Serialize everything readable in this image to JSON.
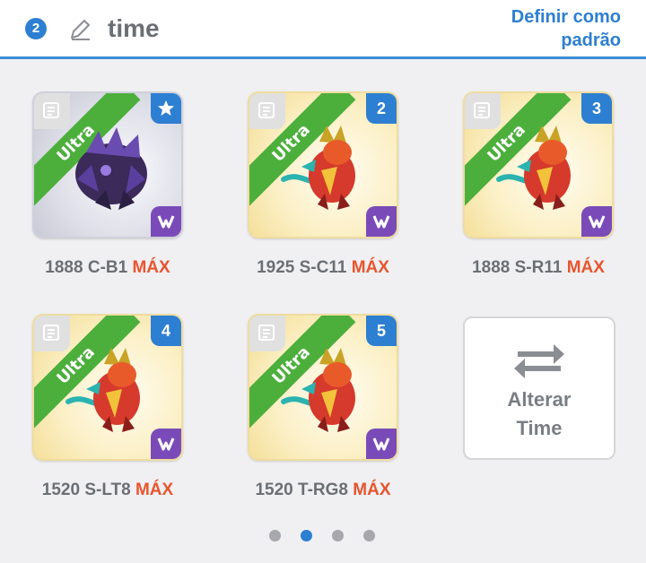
{
  "header": {
    "team_number": "2",
    "team_name": "time",
    "set_default_line1": "Definir como",
    "set_default_line2": "padrão"
  },
  "monsters": [
    {
      "rarity": "Ultra",
      "slot": "★",
      "leader": true,
      "name": "1888 C-B1",
      "max": "MÁX",
      "element": "dark",
      "bg": "gray"
    },
    {
      "rarity": "Ultra",
      "slot": "2",
      "leader": false,
      "name": "1925 S-C11",
      "max": "MÁX",
      "element": "dark",
      "bg": "gold"
    },
    {
      "rarity": "Ultra",
      "slot": "3",
      "leader": false,
      "name": "1888 S-R11",
      "max": "MÁX",
      "element": "dark",
      "bg": "gold"
    },
    {
      "rarity": "Ultra",
      "slot": "4",
      "leader": false,
      "name": "1520 S-LT8",
      "max": "MÁX",
      "element": "dark",
      "bg": "gold"
    },
    {
      "rarity": "Ultra",
      "slot": "5",
      "leader": false,
      "name": "1520 T-RG8",
      "max": "MÁX",
      "element": "dark",
      "bg": "gold"
    }
  ],
  "swap_button": {
    "line1": "Alterar",
    "line2": "Time",
    "icon": "swap-arrows-icon"
  },
  "pagination": {
    "pages": 4,
    "active_page": 2
  },
  "colors": {
    "accent": "#2d7fd1",
    "max": "#e8542e",
    "ribbon": "#4caf3c",
    "element": "#7a4bb8"
  }
}
